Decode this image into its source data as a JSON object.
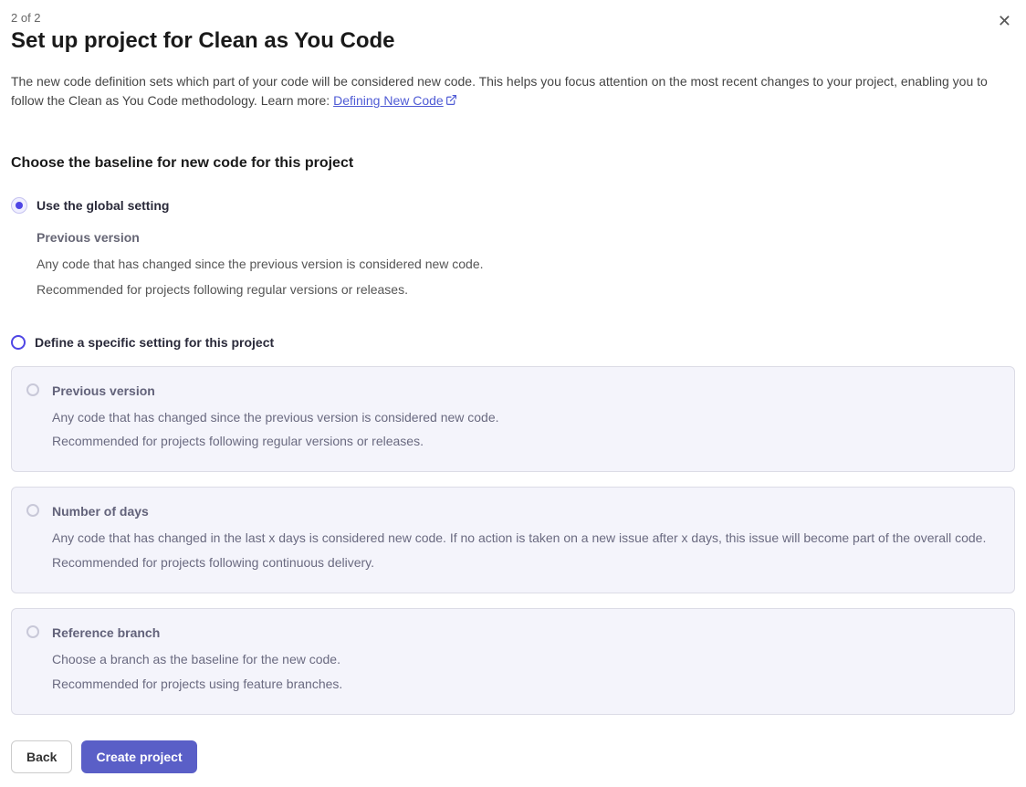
{
  "step": "2 of 2",
  "title": "Set up project for Clean as You Code",
  "intro": {
    "text": "The new code definition sets which part of your code will be considered new code. This helps you focus attention on the most recent changes to your project, enabling you to follow the Clean as You Code methodology. Learn more: ",
    "link_text": "Defining New Code"
  },
  "section_title": "Choose the baseline for new code for this project",
  "options": {
    "global": {
      "label": "Use the global setting",
      "subtitle": "Previous version",
      "desc1": "Any code that has changed since the previous version is considered new code.",
      "desc2": "Recommended for projects following regular versions or releases."
    },
    "specific": {
      "label": "Define a specific setting for this project"
    }
  },
  "cards": [
    {
      "title": "Previous version",
      "desc1": "Any code that has changed since the previous version is considered new code.",
      "desc2": "Recommended for projects following regular versions or releases."
    },
    {
      "title": "Number of days",
      "desc1": "Any code that has changed in the last x days is considered new code. If no action is taken on a new issue after x days, this issue will become part of the overall code.",
      "desc2": "Recommended for projects following continuous delivery."
    },
    {
      "title": "Reference branch",
      "desc1": "Choose a branch as the baseline for the new code.",
      "desc2": "Recommended for projects using feature branches."
    }
  ],
  "buttons": {
    "back": "Back",
    "create": "Create project"
  }
}
